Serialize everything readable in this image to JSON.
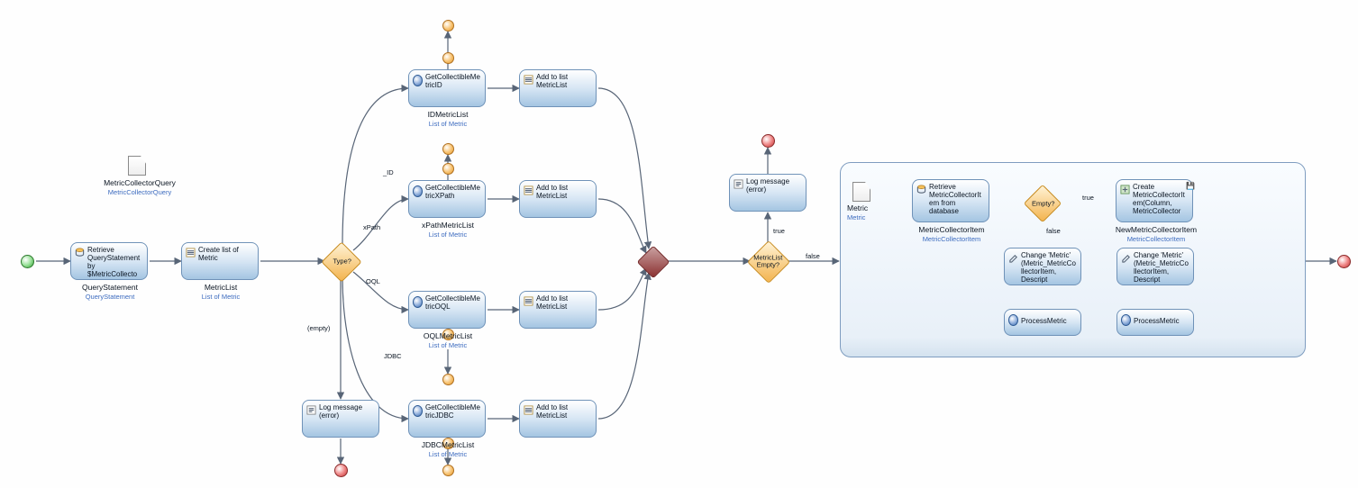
{
  "param": {
    "name": "MetricCollectorQuery",
    "type": "MetricCollectorQuery"
  },
  "nodeA_retrieve": {
    "label": "Retrieve QueryStatement by $MetricCollecto",
    "caption": "QueryStatement",
    "sub": "QueryStatement"
  },
  "nodeB_createlist": {
    "label": "Create list of Metric",
    "caption": "MetricList",
    "sub": "List of Metric"
  },
  "decisionType": {
    "label": "Type?"
  },
  "branch_labels": {
    "id": "_ID",
    "xpath": "xPath",
    "oql": "OQL",
    "jdbc": "JDBC",
    "empty": "(empty)"
  },
  "get_id": {
    "label": "GetCollectibleMetricID",
    "caption": "IDMetricList",
    "sub": "List of Metric"
  },
  "get_xpath": {
    "label": "GetCollectibleMetricXPath",
    "caption": "xPathMetricList",
    "sub": "List of Metric"
  },
  "get_oql": {
    "label": "GetCollectibleMetricOQL",
    "caption": "OQLMetricList",
    "sub": "List of Metric"
  },
  "get_jdbc": {
    "label": "GetCollectibleMetricJDBC",
    "caption": "JDBCMetricList",
    "sub": "List of Metric"
  },
  "add_id": {
    "label": "Add to list MetricList"
  },
  "add_xpath": {
    "label": "Add to list MetricList"
  },
  "add_oql": {
    "label": "Add to list MetricList"
  },
  "add_jdbc": {
    "label": "Add to list MetricList"
  },
  "log_msg_true": {
    "label": "Log message (error)"
  },
  "log_msg_empty": {
    "label": "Log message (error)"
  },
  "decisionEmpty": {
    "label": "MetricList Empty?"
  },
  "edge_true": "true",
  "edge_false": "false",
  "loop": {
    "param": {
      "name": "Metric",
      "type": "Metric"
    },
    "retrieve": {
      "label": "Retrieve MetricCollectorItem from database",
      "caption": "MetricCollectorItem",
      "sub": "MetricCollectorItem"
    },
    "decision": {
      "label": "Empty?"
    },
    "create": {
      "label": "Create MetricCollectorItem(Column, MetricCollector",
      "caption": "NewMetricCollectorItem",
      "sub": "MetricCollectorItem"
    },
    "change1": {
      "label": "Change 'Metric' (Metric_MetricCollectorItem, Descript"
    },
    "change2": {
      "label": "Change 'Metric' (Metric_MetricCollectorItem, Descript"
    },
    "proc1": {
      "label": "ProcessMetric"
    },
    "proc2": {
      "label": "ProcessMetric"
    }
  }
}
